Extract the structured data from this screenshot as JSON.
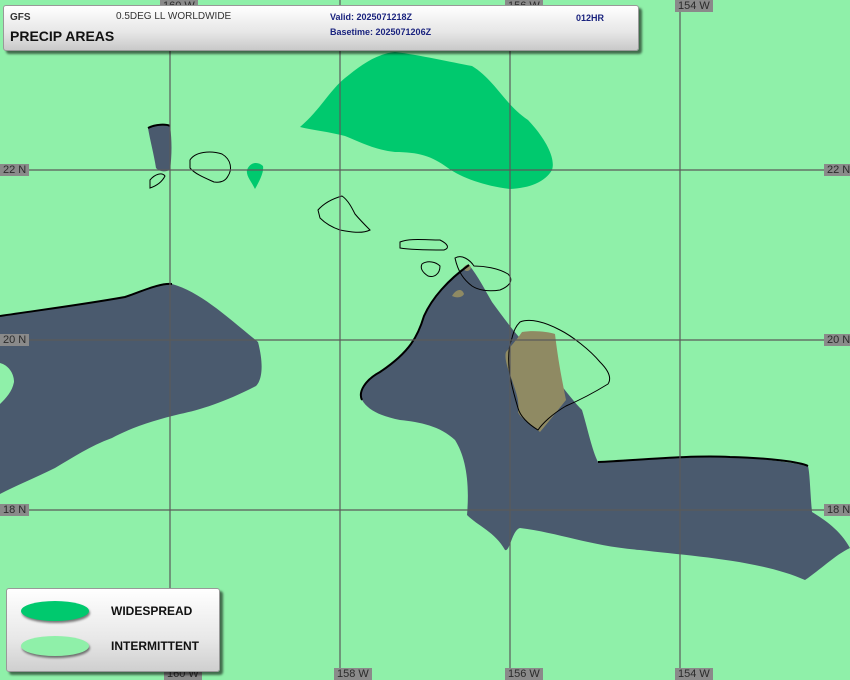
{
  "header": {
    "model": "GFS",
    "product": "0.5DEG LL WORLDWIDE",
    "title": "PRECIP AREAS",
    "valid": "Valid: 2025071218Z",
    "basetime": "Basetime: 2025071206Z",
    "forecast_hour": "012HR"
  },
  "grid": {
    "longitude_labels": [
      "160 W",
      "158 W",
      "156 W",
      "154 W"
    ],
    "latitude_labels": [
      "22 N",
      "20 N",
      "18 N"
    ]
  },
  "legend": {
    "items": [
      {
        "label": "WIDESPREAD",
        "color": "#00c96e"
      },
      {
        "label": "INTERMITTENT",
        "color": "#8ff0a9"
      }
    ]
  },
  "colors": {
    "intermittent": "#8ff0a9",
    "widespread": "#00c96e",
    "no_precip_area": "#4a5a6e",
    "land_no_precip": "#8f8a63",
    "coastline": "#000000",
    "grid": "#5a5a5a"
  }
}
